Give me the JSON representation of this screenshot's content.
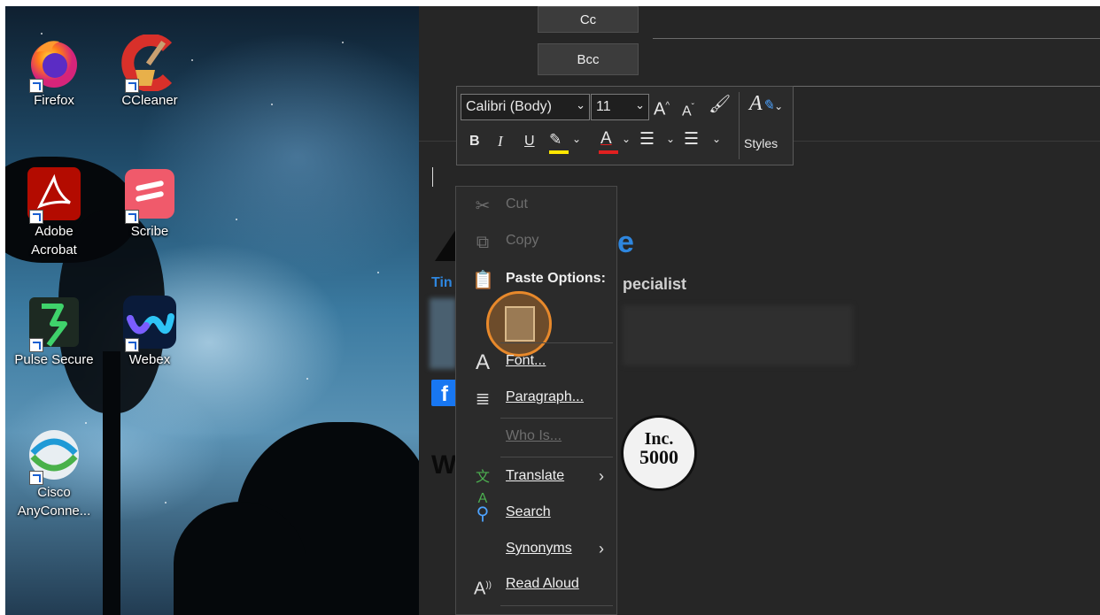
{
  "desktop": {
    "icons": [
      {
        "label": "Firefox",
        "icon": "firefox-icon"
      },
      {
        "label": "CCleaner",
        "icon": "ccleaner-icon"
      },
      {
        "label": "Adobe Acrobat",
        "icon": "adobe-acrobat-icon"
      },
      {
        "label": "Scribe",
        "icon": "scribe-icon"
      },
      {
        "label": "Pulse Secure",
        "icon": "pulse-secure-icon"
      },
      {
        "label": "Webex",
        "icon": "webex-icon"
      },
      {
        "label": "Cisco AnyConne...",
        "icon": "cisco-anyconnect-icon"
      }
    ]
  },
  "compose": {
    "cc_label": "Cc",
    "bcc_label": "Bcc"
  },
  "mini_toolbar": {
    "font_name": "Calibri (Body)",
    "font_size": "11",
    "bold": "B",
    "italic": "I",
    "underline": "U",
    "font_color_letter": "A",
    "grow_font": "A",
    "shrink_font": "A",
    "styles_label": "Styles",
    "highlight_color": "#ffe600",
    "font_color": "#e02020"
  },
  "context_menu": {
    "cut": "Cut",
    "copy": "Copy",
    "paste_options": "Paste Options:",
    "font": "Font...",
    "paragraph": "Paragraph...",
    "who_is": "Who Is...",
    "translate": "Translate",
    "search": "Search",
    "synonyms": "Synonyms",
    "read_aloud": "Read Aloud"
  },
  "signature": {
    "name_fragment": "Tin",
    "title_fragment": "pecialist",
    "letter_fragment": "W",
    "badge_top": "Inc.",
    "badge_bottom": "5000",
    "facebook": "f"
  },
  "colors": {
    "highlight_ring": "#e8892b",
    "outlook_bg": "#262626",
    "menu_bg": "#2b2b2b"
  }
}
